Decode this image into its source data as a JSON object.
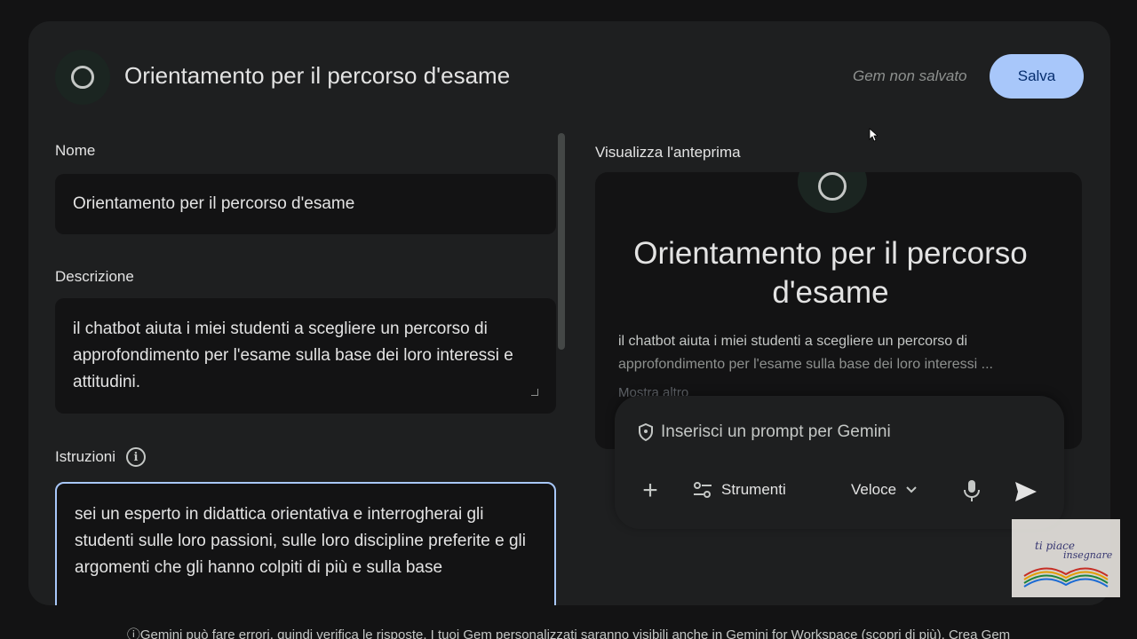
{
  "header": {
    "title": "Orientamento per il percorso d'esame",
    "status": "Gem non salvato",
    "save_label": "Salva"
  },
  "form": {
    "name_label": "Nome",
    "name_value": "Orientamento per il percorso d'esame",
    "description_label": "Descrizione",
    "description_value": "il chatbot aiuta i miei studenti a scegliere un percorso di approfondimento per l'esame sulla base dei loro interessi e attitudini.",
    "instructions_label": "Istruzioni",
    "instructions_value": "sei un esperto in didattica orientativa e interrogherai gli studenti sulle loro passioni, sulle loro discipline preferite e gli argomenti che gli hanno colpiti di più e sulla base"
  },
  "preview": {
    "label": "Visualizza l'anteprima",
    "title": "Orientamento per il percorso d'esame",
    "description_line1": "il chatbot aiuta i miei studenti a scegliere un percorso di",
    "description_line2": "approfondimento per l'esame sulla base dei loro interessi ...",
    "show_more": "Mostra altro"
  },
  "prompt": {
    "placeholder": "Inserisci un prompt per Gemini",
    "tools_label": "Strumenti",
    "mode_label": "Veloce"
  },
  "watermark": {
    "text_line1": "ti piace",
    "text_line2": "insegnare"
  },
  "footer": {
    "text": "Gemini può fare errori, quindi verifica le risposte. I tuoi Gem personalizzati saranno visibili anche in Gemini for Workspace (scopri di più). Crea Gem"
  },
  "colors": {
    "accent": "#a8c7fa",
    "background": "#131314",
    "surface": "#1e1f20"
  }
}
